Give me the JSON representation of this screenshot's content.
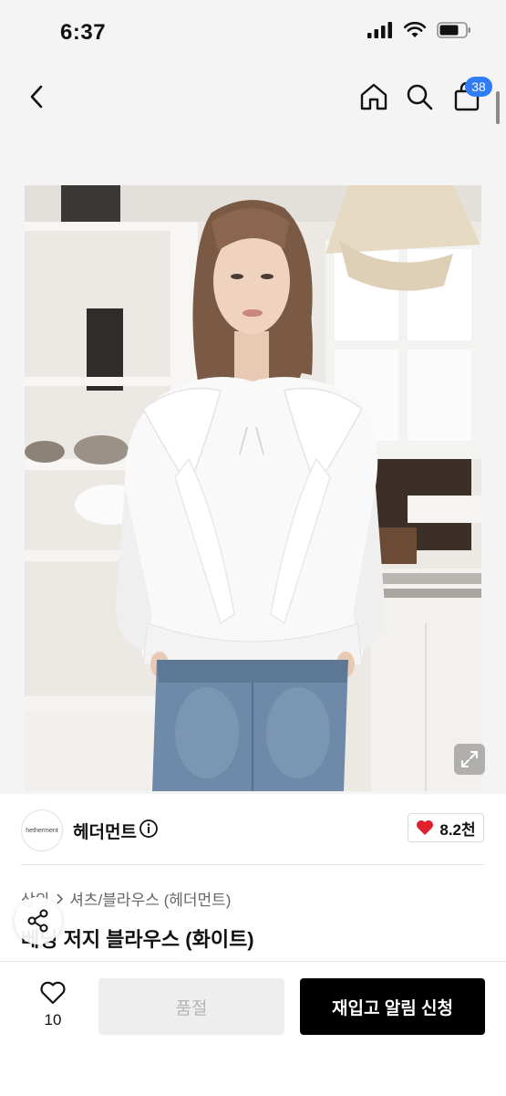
{
  "status": {
    "time": "6:37"
  },
  "nav": {
    "back_icon": "chevron-left-icon",
    "home_icon": "home-icon",
    "search_icon": "search-icon",
    "cart_icon": "shopping-bag-icon",
    "cart_count": "38"
  },
  "product": {
    "brand_logo_text": "hetherment",
    "brand_name": "헤더먼트",
    "like_count": "8.2천",
    "breadcrumb": [
      "상의",
      "셔츠/블라우스 (헤더먼트)"
    ],
    "title": "베닝 저지 블라우스 (화이트)"
  },
  "bottom": {
    "wish_count": "10",
    "soldout_label": "품절",
    "notify_label": "재입고 알림 신청"
  },
  "colors": {
    "badge": "#2f7cf6",
    "heart": "#e0202a",
    "primary_button": "#000000",
    "disabled_button": "#eeeeee"
  }
}
